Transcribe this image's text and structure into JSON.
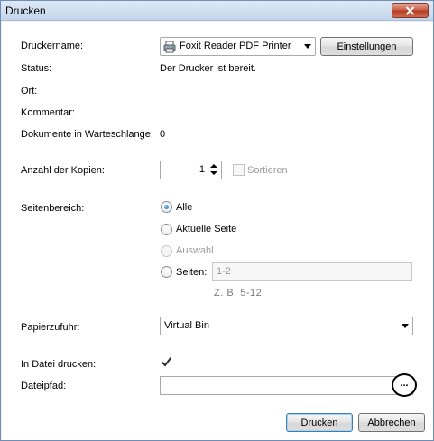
{
  "window": {
    "title": "Drucken"
  },
  "printer": {
    "name_label": "Druckername:",
    "name_value": "Foxit Reader PDF Printer",
    "settings_button": "Einstellungen",
    "status_label": "Status:",
    "status_value": "Der Drucker ist bereit.",
    "location_label": "Ort:",
    "comment_label": "Kommentar:",
    "queue_label": "Dokumente in Warteschlange:",
    "queue_value": "0"
  },
  "copies": {
    "label": "Anzahl der Kopien:",
    "value": "1",
    "collate_label": "Sortieren",
    "collate_checked": false
  },
  "page_range": {
    "label": "Seitenbereich:",
    "options": [
      {
        "label": "Alle",
        "checked": true,
        "enabled": true
      },
      {
        "label": "Aktuelle Seite",
        "checked": false,
        "enabled": true
      },
      {
        "label": "Auswahl",
        "checked": false,
        "enabled": false
      },
      {
        "label": "Seiten:",
        "checked": false,
        "enabled": true
      }
    ],
    "pages_value": "1-2",
    "pages_hint": "Z. B. 5-12"
  },
  "paper_source": {
    "label": "Papierzufuhr:",
    "value": "Virtual Bin"
  },
  "print_to_file": {
    "label": "In Datei drucken:",
    "checked": true
  },
  "file_path": {
    "label": "Dateipfad:",
    "value": "",
    "browse_label": "..."
  },
  "footer": {
    "print_button": "Drucken",
    "cancel_button": "Abbrechen"
  }
}
